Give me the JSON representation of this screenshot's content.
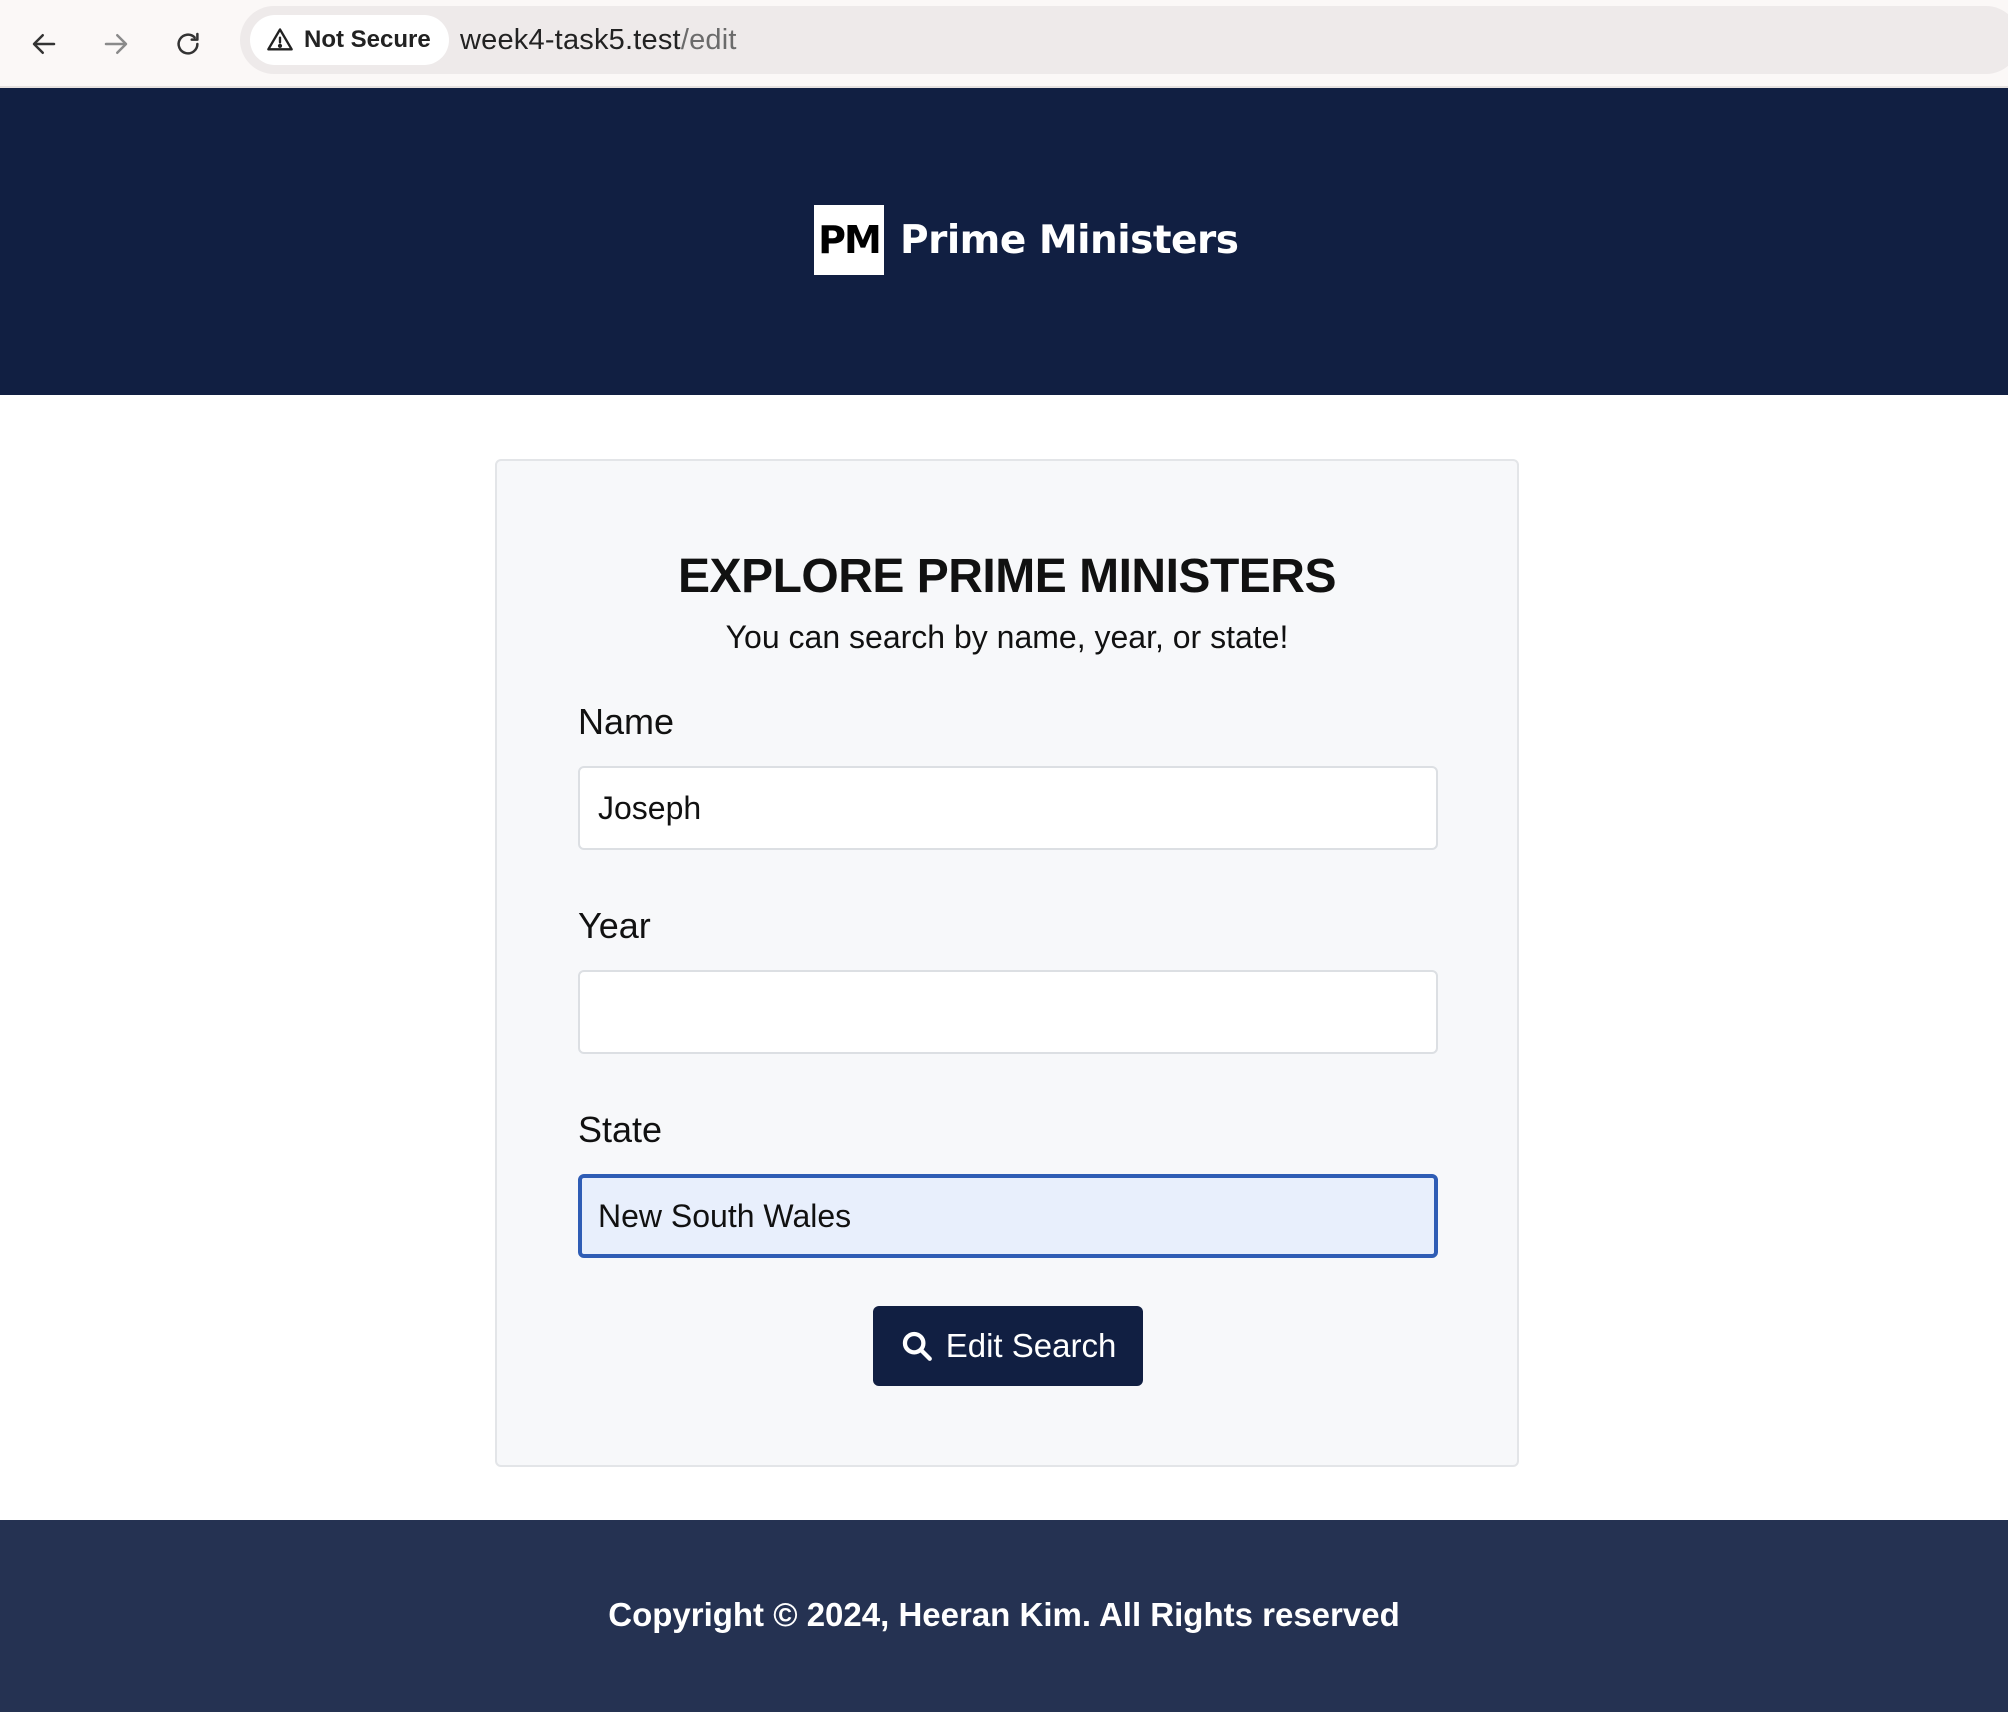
{
  "browser": {
    "security_label": "Not Secure",
    "url_host": "week4-task5.test",
    "url_path": "/edit",
    "icons": {
      "back": "back-arrow-icon",
      "forward": "forward-arrow-icon",
      "reload": "reload-icon",
      "security": "warning-triangle-icon"
    }
  },
  "header": {
    "logo_text": "PM",
    "site_name": "Prime Ministers",
    "background_color": "#111f42"
  },
  "search_form": {
    "title": "EXPLORE PRIME MINISTERS",
    "subtitle": "You can search by name, year, or state!",
    "fields": {
      "name": {
        "label": "Name",
        "value": "Joseph"
      },
      "year": {
        "label": "Year",
        "value": ""
      },
      "state": {
        "label": "State",
        "value": "New South Wales",
        "focused": true
      }
    },
    "submit": {
      "label": "Edit Search",
      "icon": "search-icon"
    },
    "focus_color": "#2f5db5"
  },
  "footer": {
    "copyright": "Copyright © 2024, Heeran Kim. All Rights reserved",
    "background_color": "#253252"
  }
}
